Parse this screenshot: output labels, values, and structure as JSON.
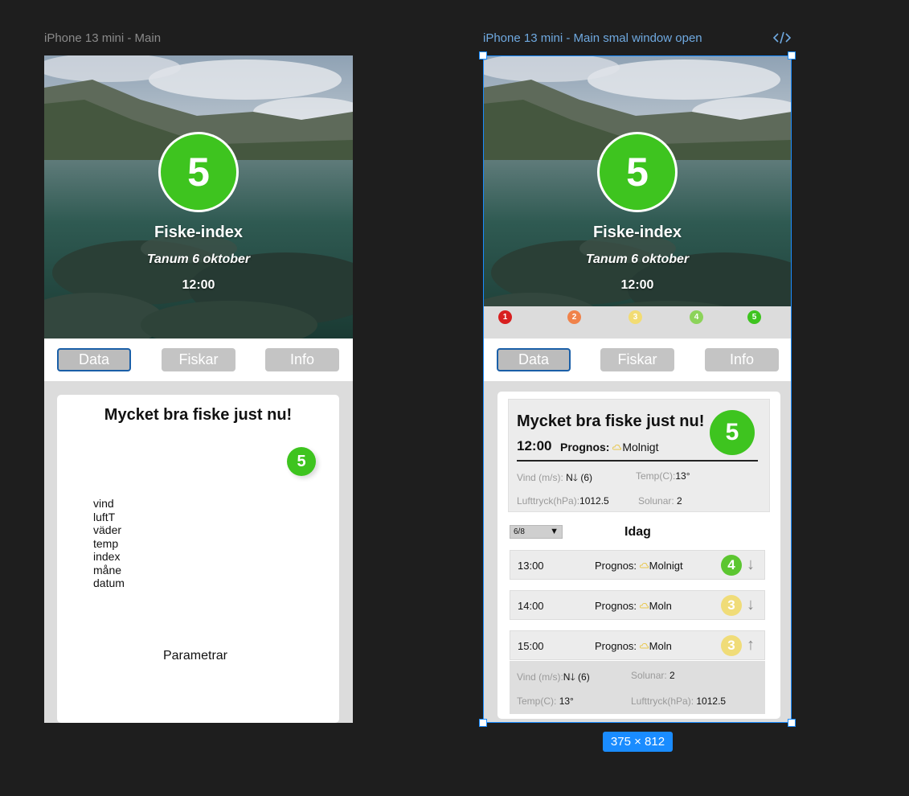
{
  "canvas": {
    "left_frame_label": "iPhone 13 mini - Main",
    "right_frame_label": "iPhone 13 mini - Main smal window open",
    "size_badge": "375 × 812",
    "code_icon": "code-icon"
  },
  "hero": {
    "index_value": "5",
    "title": "Fiske-index",
    "location_date": "Tanum 6 oktober",
    "time": "12:00"
  },
  "scale": [
    {
      "label": "1",
      "color": "#d81f1f"
    },
    {
      "label": "2",
      "color": "#f0824a"
    },
    {
      "label": "3",
      "color": "#f2dc73"
    },
    {
      "label": "4",
      "color": "#8cd35a"
    },
    {
      "label": "5",
      "color": "#3ec41f"
    }
  ],
  "tabs": [
    "Data",
    "Fiskar",
    "Info"
  ],
  "left_card": {
    "heading": "Mycket bra fiske just nu!",
    "badge": "5",
    "params": [
      "vind",
      "luftT",
      "väder",
      "temp",
      "index",
      "måne",
      "datum"
    ],
    "params_title": "Parametrar"
  },
  "summary": {
    "heading": "Mycket bra fiske just nu!",
    "time": "12:00",
    "prognos_label": "Prognos:",
    "prognos_value": "Molnigt",
    "badge": "5",
    "wind_label": "Vind (m/s):",
    "wind_value": "N🡓 (6)",
    "temp_label": "Temp(C):",
    "temp_value": "13°",
    "pressure_label": "Lufttryck(hPa):",
    "pressure_value": "1012.5",
    "solunar_label": "Solunar:",
    "solunar_value": "2"
  },
  "forecast": {
    "date_selected": "6/8",
    "day_title": "Idag",
    "hours": [
      {
        "time": "13:00",
        "prognos_label": "Prognos:",
        "prognos_value": "Molnigt",
        "index": "4",
        "index_color": "#5cc630",
        "arrow": "↓"
      },
      {
        "time": "14:00",
        "prognos_label": "Prognos:",
        "prognos_value": "Moln",
        "index": "3",
        "index_color": "#f0dc78",
        "arrow": "↓"
      },
      {
        "time": "15:00",
        "prognos_label": "Prognos:",
        "prognos_value": "Moln",
        "index": "3",
        "index_color": "#f0dc78",
        "arrow": "↑"
      }
    ],
    "expanded": {
      "wind_label": "Vind (m/s):",
      "wind_value": "N🡓 (6)",
      "solunar_label": "Solunar:",
      "solunar_value": "2",
      "temp_label": "Temp(C):",
      "temp_value": "13°",
      "pressure_label": "Lufttryck(hPa):",
      "pressure_value": "1012.5"
    }
  }
}
